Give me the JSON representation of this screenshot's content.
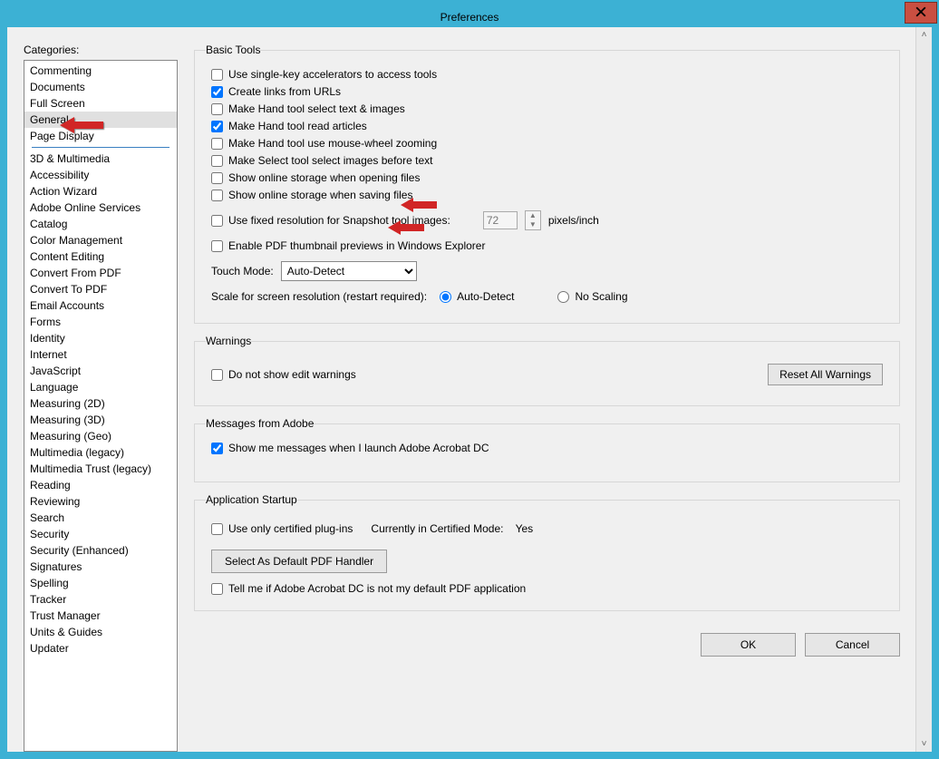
{
  "window": {
    "title": "Preferences"
  },
  "sidebar": {
    "label": "Categories:",
    "items1": [
      {
        "label": "Commenting"
      },
      {
        "label": "Documents"
      },
      {
        "label": "Full Screen"
      },
      {
        "label": "General",
        "selected": true
      },
      {
        "label": "Page Display"
      }
    ],
    "items2": [
      {
        "label": "3D & Multimedia"
      },
      {
        "label": "Accessibility"
      },
      {
        "label": "Action Wizard"
      },
      {
        "label": "Adobe Online Services"
      },
      {
        "label": "Catalog"
      },
      {
        "label": "Color Management"
      },
      {
        "label": "Content Editing"
      },
      {
        "label": "Convert From PDF"
      },
      {
        "label": "Convert To PDF"
      },
      {
        "label": "Email Accounts"
      },
      {
        "label": "Forms"
      },
      {
        "label": "Identity"
      },
      {
        "label": "Internet"
      },
      {
        "label": "JavaScript"
      },
      {
        "label": "Language"
      },
      {
        "label": "Measuring (2D)"
      },
      {
        "label": "Measuring (3D)"
      },
      {
        "label": "Measuring (Geo)"
      },
      {
        "label": "Multimedia (legacy)"
      },
      {
        "label": "Multimedia Trust (legacy)"
      },
      {
        "label": "Reading"
      },
      {
        "label": "Reviewing"
      },
      {
        "label": "Search"
      },
      {
        "label": "Security"
      },
      {
        "label": "Security (Enhanced)"
      },
      {
        "label": "Signatures"
      },
      {
        "label": "Spelling"
      },
      {
        "label": "Tracker"
      },
      {
        "label": "Trust Manager"
      },
      {
        "label": "Units & Guides"
      },
      {
        "label": "Updater"
      }
    ]
  },
  "basicTools": {
    "legend": "Basic Tools",
    "opts": {
      "singleKey": {
        "label": "Use single-key accelerators to access tools",
        "checked": false
      },
      "linksFromURLs": {
        "label": "Create links from URLs",
        "checked": true
      },
      "handSelect": {
        "label": "Make Hand tool select text & images",
        "checked": false
      },
      "handArticles": {
        "label": "Make Hand tool read articles",
        "checked": true
      },
      "handWheel": {
        "label": "Make Hand tool use mouse-wheel zooming",
        "checked": false
      },
      "selectImages": {
        "label": "Make Select tool select images before text",
        "checked": false
      },
      "onlineOpen": {
        "label": "Show online storage when opening files",
        "checked": false
      },
      "onlineSave": {
        "label": "Show online storage when saving files",
        "checked": false
      }
    },
    "snapshot": {
      "label": "Use fixed resolution for Snapshot tool images:",
      "checked": false,
      "value": "72",
      "units": "pixels/inch"
    },
    "thumbPreview": {
      "label": "Enable PDF thumbnail previews in Windows Explorer",
      "checked": false
    },
    "touchMode": {
      "label": "Touch Mode:",
      "value": "Auto-Detect"
    },
    "scale": {
      "label": "Scale for screen resolution (restart required):",
      "opt1": "Auto-Detect",
      "opt2": "No Scaling",
      "selected": "auto"
    }
  },
  "warnings": {
    "legend": "Warnings",
    "noEditWarn": {
      "label": "Do not show edit warnings",
      "checked": false
    },
    "resetBtn": "Reset All Warnings"
  },
  "messages": {
    "legend": "Messages from Adobe",
    "showLaunch": {
      "label": "Show me messages when I launch Adobe Acrobat DC",
      "checked": true
    }
  },
  "startup": {
    "legend": "Application Startup",
    "certifiedOnly": {
      "label": "Use only certified plug-ins",
      "checked": false
    },
    "certModeLabel": "Currently in Certified Mode:",
    "certModeValue": "Yes",
    "defaultHandlerBtn": "Select As Default PDF Handler",
    "tellMeDefault": {
      "label": "Tell me if Adobe Acrobat DC is not my default PDF application",
      "checked": false
    }
  },
  "dialog": {
    "ok": "OK",
    "cancel": "Cancel"
  }
}
